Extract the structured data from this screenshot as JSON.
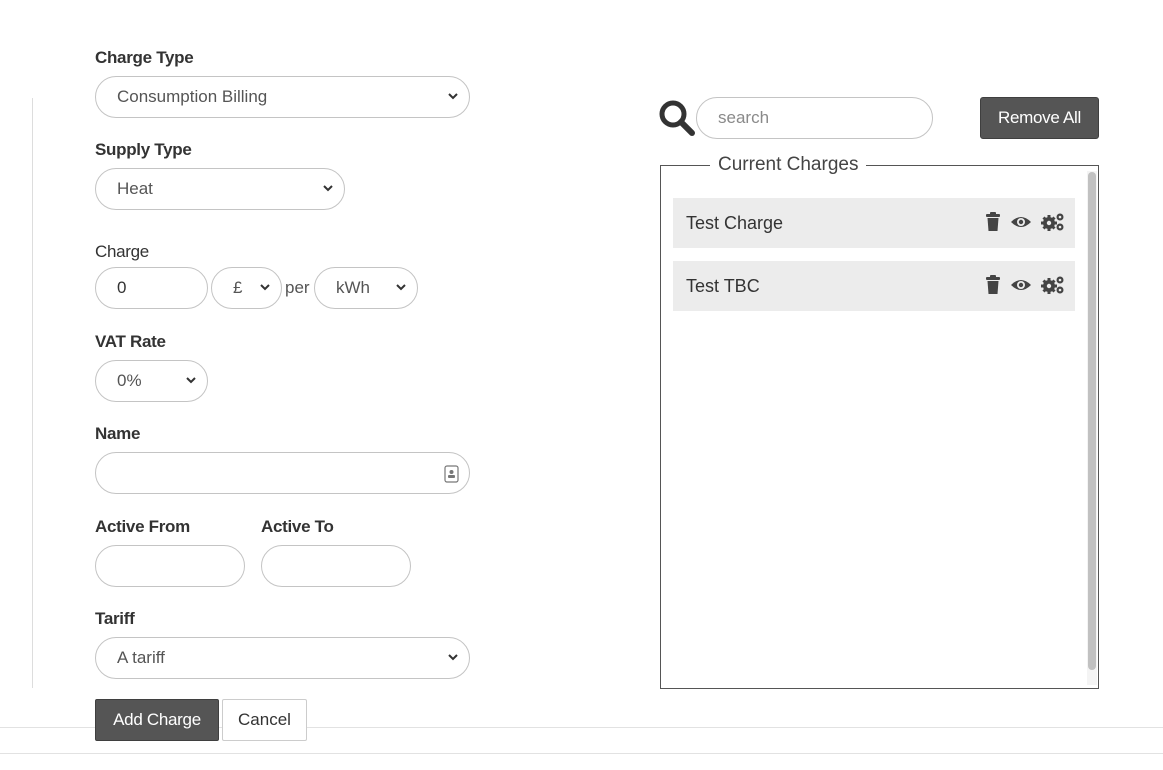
{
  "form": {
    "charge_type": {
      "label": "Charge Type",
      "value": "Consumption Billing"
    },
    "supply_type": {
      "label": "Supply Type",
      "value": "Heat"
    },
    "charge": {
      "label": "Charge",
      "amount": "0",
      "currency": "£",
      "per_text": "per",
      "unit": "kWh"
    },
    "vat_rate": {
      "label": "VAT Rate",
      "value": "0%"
    },
    "name": {
      "label": "Name",
      "value": ""
    },
    "active_from": {
      "label": "Active From",
      "value": ""
    },
    "active_to": {
      "label": "Active To",
      "value": ""
    },
    "tariff": {
      "label": "Tariff",
      "value": "A tariff"
    },
    "add_button": "Add Charge",
    "cancel_button": "Cancel"
  },
  "charges_panel": {
    "search": {
      "placeholder": "search",
      "value": ""
    },
    "remove_all_button": "Remove All",
    "legend": "Current Charges",
    "items": [
      {
        "name": "Test Charge"
      },
      {
        "name": "Test TBC"
      }
    ]
  },
  "icons": [
    "search-icon",
    "chevron-down-icon",
    "contact-card-icon",
    "trash-icon",
    "eye-icon",
    "gears-icon"
  ],
  "colors": {
    "dark_button": "#555555",
    "row_bg": "#ececec",
    "icon": "#444444"
  }
}
